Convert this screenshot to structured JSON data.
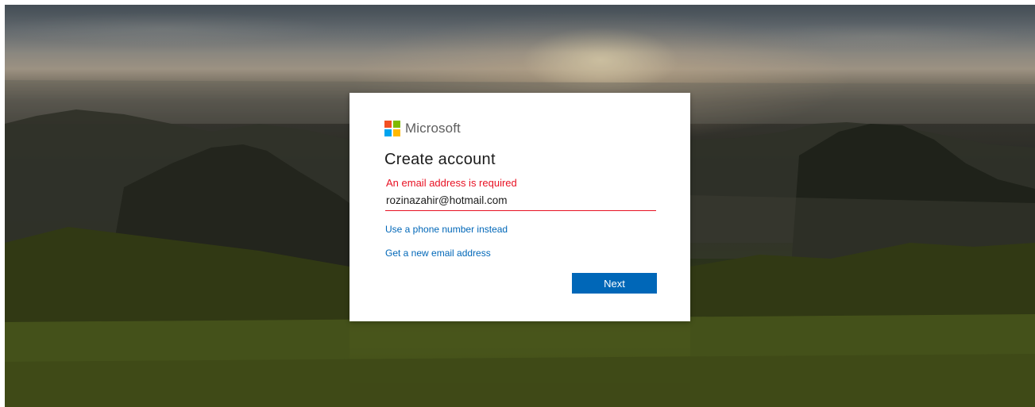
{
  "brand": {
    "name": "Microsoft",
    "logo_colors": [
      "#f25022",
      "#7fba00",
      "#00a4ef",
      "#ffb900"
    ]
  },
  "form": {
    "title": "Create account",
    "error_message": "An email address is required",
    "email_value": "rozinazahir@hotmail.com",
    "phone_link_label": "Use a phone number instead",
    "new_email_link_label": "Get a new email address",
    "next_label": "Next"
  },
  "colors": {
    "accent": "#0067b8",
    "error": "#e81123"
  }
}
